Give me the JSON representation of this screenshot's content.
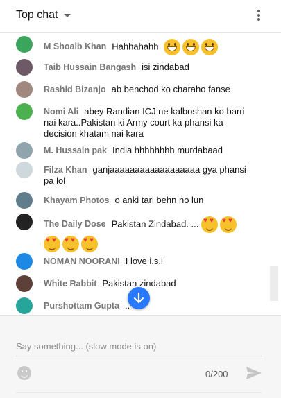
{
  "header": {
    "title": "Top chat",
    "caret_icon": "caret-down-icon",
    "menu_icon": "more-vert-icon"
  },
  "messages": [
    {
      "author": "M Shoaib Khan",
      "text": "Hahhahahh",
      "emoji": [
        "grin",
        "grin",
        "grin"
      ],
      "avatar_color": "#3ba55d"
    },
    {
      "author": "Taib Hussain Bangash",
      "text": "isi zindabad",
      "emoji": [],
      "avatar_color": "#6d5a66"
    },
    {
      "author": "Rashid Bizanjo",
      "text": "ab benchod ko charaho fanse",
      "emoji": [],
      "avatar_color": "#a1887f"
    },
    {
      "author": "Nomi Ali",
      "text": "abey Randian ICJ ne kalboshan ko barri nai kara..Pakistan ki Army court ka phansi ka decision khatam nai kara",
      "emoji": [],
      "avatar_color": "#4caf50"
    },
    {
      "author": "M. Hussain pak",
      "text": "India hhhhhhhh murdabaad",
      "emoji": [],
      "avatar_color": "#90a4ae"
    },
    {
      "author": "Filza Khan",
      "text": "ganjaaaaaaaaaaaaaaaaaa gya phansi pa lol",
      "emoji": [],
      "avatar_color": "#cfd8dc"
    },
    {
      "author": "Khayam Photos",
      "text": "o anki tari behn no lun",
      "emoji": [],
      "avatar_color": "#607d8b"
    },
    {
      "author": "The Daily Dose",
      "text": "Pakistan Zindabad. ...",
      "emoji": [
        "heart",
        "heart",
        "heart",
        "heart",
        "heart"
      ],
      "avatar_color": "#222222"
    },
    {
      "author": "NOMAN NOORANI",
      "text": "I love i.s.i",
      "emoji": [],
      "avatar_color": "#1e88e5"
    },
    {
      "author": "White Rabbit",
      "text": "Pakistan zindabad",
      "emoji": [],
      "avatar_color": "#5d4037"
    },
    {
      "author": "Purshottam Gupta",
      "text": "..",
      "emoji": [],
      "avatar_color": "#26a69a"
    }
  ],
  "jump_button_icon": "arrow-down-icon",
  "composer": {
    "placeholder": "Say something... (slow mode is on)",
    "counter": "0/200",
    "emoji_icon": "smiley-icon",
    "send_icon": "send-icon"
  },
  "colors": {
    "accent": "#2979ff",
    "author": "#767676"
  }
}
